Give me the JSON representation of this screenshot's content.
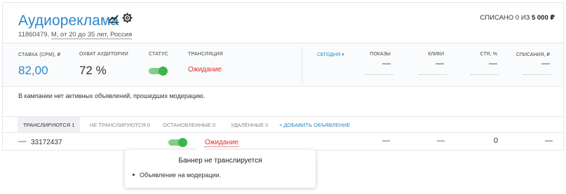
{
  "campaign": {
    "title": "Аудиореклама",
    "id": "11860479,",
    "targeting": "М, от 20 до 35 лет, Россия",
    "spent_prefix": "СПИСАНО 0 ИЗ",
    "spent_total": "5 000",
    "currency_symbol": "₽"
  },
  "icons": {
    "stats": "chart-icon",
    "settings": "gear-icon",
    "sort": "sort-icon"
  },
  "stats": {
    "bid_label": "СТАВКА (CPM), ₽",
    "bid_value": "82,00",
    "reach_label": "ОХВАТ АУДИТОРИИ",
    "reach_value": "72 %",
    "status_label": "СТАТУС",
    "status_on": true,
    "broadcast_label": "ТРАНСЛЯЦИЯ",
    "broadcast_value": "Ожидание",
    "period": "СЕГОДНЯ ▾",
    "metrics": [
      {
        "label": "ПОКАЗЫ",
        "value": "—"
      },
      {
        "label": "КЛИКИ",
        "value": "—"
      },
      {
        "label": "CTR, %",
        "value": "—"
      },
      {
        "label": "СПИСАНИЯ, ₽",
        "value": "—"
      }
    ]
  },
  "notice": "В кампании нет активных объявлений, прошедших модерацию.",
  "tabs": {
    "active": "ТРАНСЛИРУЮТСЯ 1",
    "not_broadcast": "НЕ ТРАНСЛИРУЮТСЯ 0",
    "stopped": "ОСТАНОВЛЕННЫЕ 0",
    "deleted": "УДАЛЁННЫЕ 0",
    "add": "+ ДОБАВИТЬ ОБЪЯВЛЕНИЕ"
  },
  "ad_row": {
    "dash": "—",
    "id": "33172437",
    "status_on": true,
    "broadcast": "Ожидание",
    "impressions": "—",
    "clicks": "—",
    "ctr": "0",
    "spend": "—"
  },
  "tooltip": {
    "title": "Баннер не транслируется",
    "item": "Объявление на модерации."
  },
  "colors": {
    "accent": "#2b87c8",
    "pending": "#d9342b",
    "toggle_on": "#3ab54a"
  }
}
